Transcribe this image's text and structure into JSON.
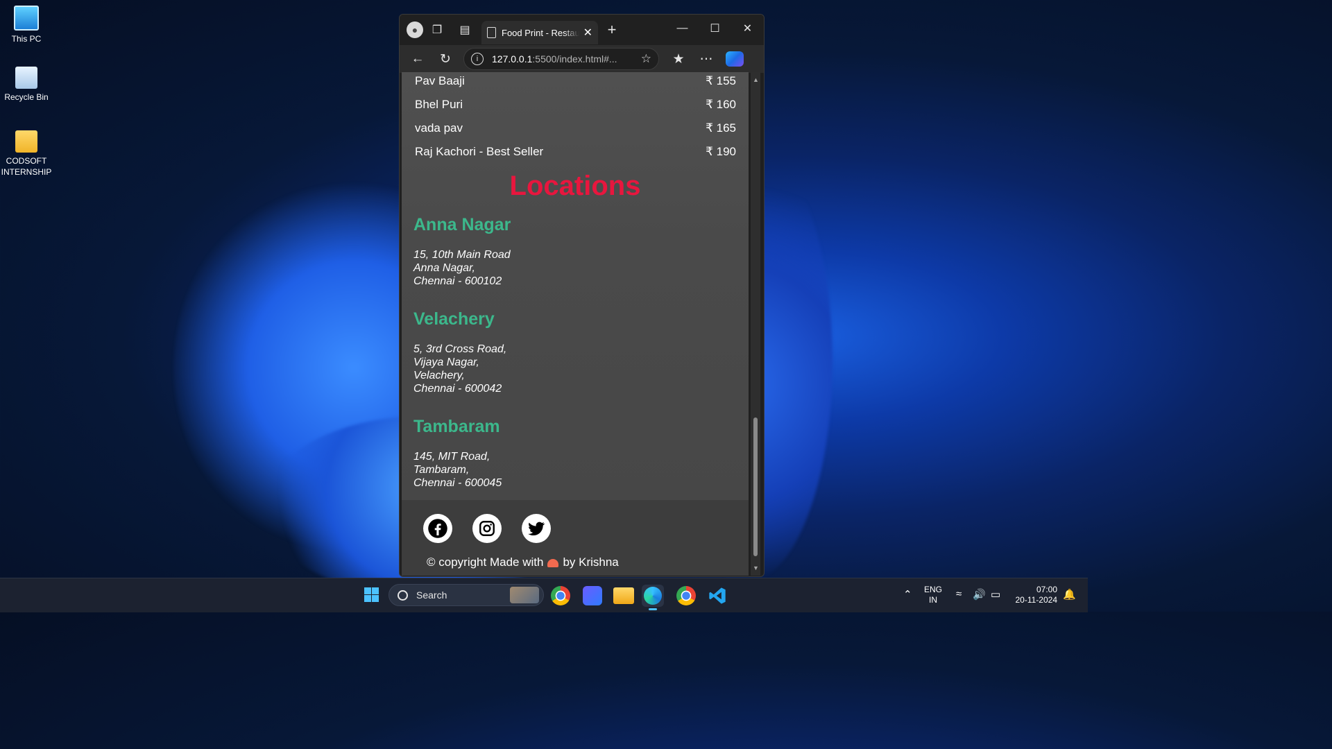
{
  "desktop": {
    "icons": [
      {
        "label": "This PC"
      },
      {
        "label": "Recycle Bin"
      },
      {
        "label": "CODSOFT INTERNSHIP"
      }
    ]
  },
  "browser": {
    "tab_title": "Food Print - Restaurant",
    "url_host": "127.0.0.1",
    "url_rest": ":5500/index.html#..."
  },
  "page": {
    "menu_items": [
      {
        "name": "Pav Baaji",
        "price": "₹ 155"
      },
      {
        "name": "Bhel Puri",
        "price": "₹ 160"
      },
      {
        "name": "vada pav",
        "price": "₹ 165"
      },
      {
        "name": "Raj Kachori - Best Seller",
        "price": "₹ 190"
      }
    ],
    "locations_heading": "Locations",
    "locations": [
      {
        "city": "Anna Nagar",
        "lines": [
          "15, 10th Main Road",
          "Anna Nagar,",
          "Chennai - 600102"
        ]
      },
      {
        "city": "Velachery",
        "lines": [
          "5, 3rd Cross Road,",
          "Vijaya Nagar,",
          "Velachery,",
          "Chennai - 600042"
        ]
      },
      {
        "city": "Tambaram",
        "lines": [
          "145, MIT Road,",
          "Tambaram,",
          "Chennai - 600045"
        ]
      }
    ],
    "footer": {
      "copyright_prefix": "© copyright Made with",
      "copyright_suffix": "by Krishna",
      "social": [
        "facebook-icon",
        "instagram-icon",
        "twitter-icon"
      ]
    }
  },
  "taskbar": {
    "search_placeholder": "Search",
    "lang_top": "ENG",
    "lang_bottom": "IN",
    "time": "07:00",
    "date": "20-11-2024"
  }
}
